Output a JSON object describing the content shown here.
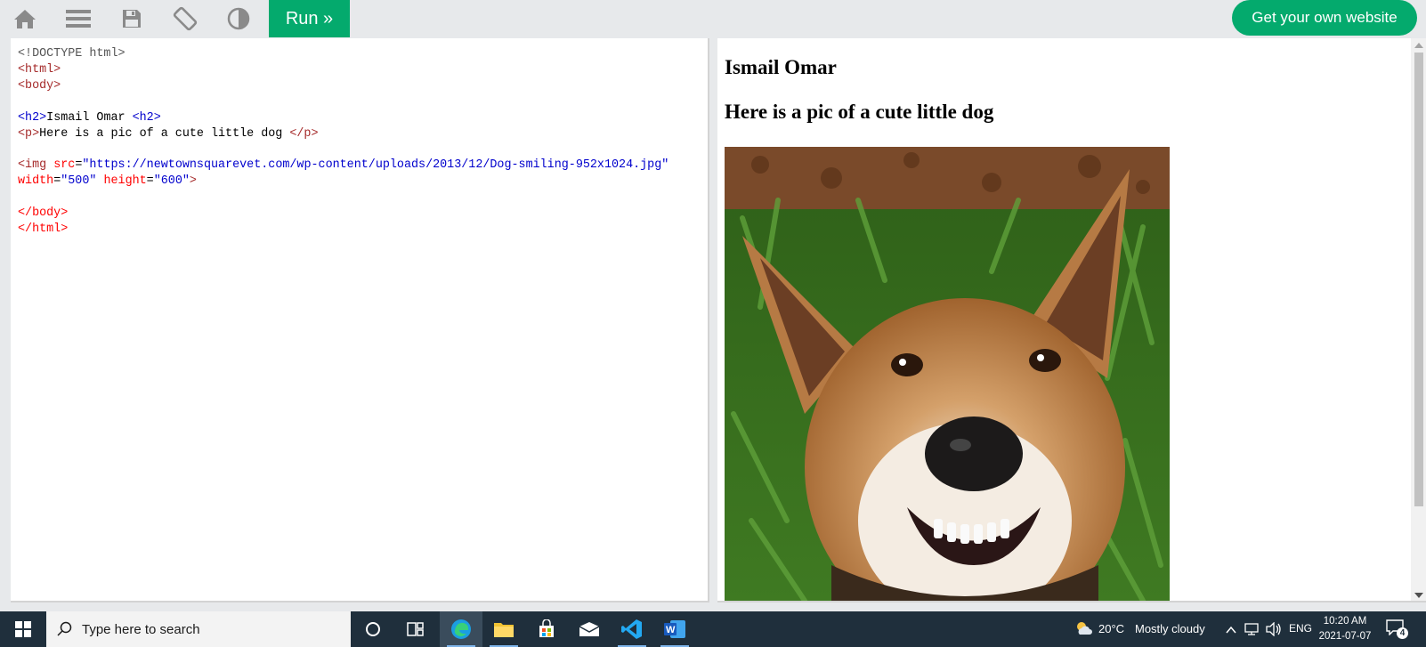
{
  "toolbar": {
    "icons": [
      "home-icon",
      "menu-icon",
      "save-icon",
      "rotate-icon",
      "contrast-icon"
    ],
    "run_label": "Run »",
    "get_website_label": "Get your own website"
  },
  "code_editor": {
    "lines": [
      "<!DOCTYPE html>",
      "<html>",
      "<body>",
      "",
      "<h2>Ismail Omar <h2>",
      "<p>Here is a pic of a cute little dog </p>",
      "",
      "<img src=\"https://newtownsquarevet.com/wp-content/uploads/2013/12/Dog-smiling-952x1024.jpg\"",
      "width=\"500\" height=\"600\">",
      "",
      "</body>",
      "</html>"
    ]
  },
  "result": {
    "heading": "Ismail Omar",
    "paragraph": "Here is a pic of a cute little dog",
    "image_alt": "smiling dog"
  },
  "taskbar": {
    "search_placeholder": "Type here to search",
    "apps": [
      "cortana-icon",
      "task-view-icon",
      "edge-icon",
      "file-explorer-icon",
      "store-icon",
      "mail-icon",
      "vscode-icon",
      "word-icon"
    ],
    "weather_temp": "20°C",
    "weather_text": "Mostly cloudy",
    "language": "ENG",
    "time": "10:20 AM",
    "date": "2021-07-07",
    "notification_count": "4"
  },
  "colors": {
    "accent": "#04aa6d",
    "taskbar": "#1f2f3c",
    "toolbar": "#e7e9eb"
  }
}
